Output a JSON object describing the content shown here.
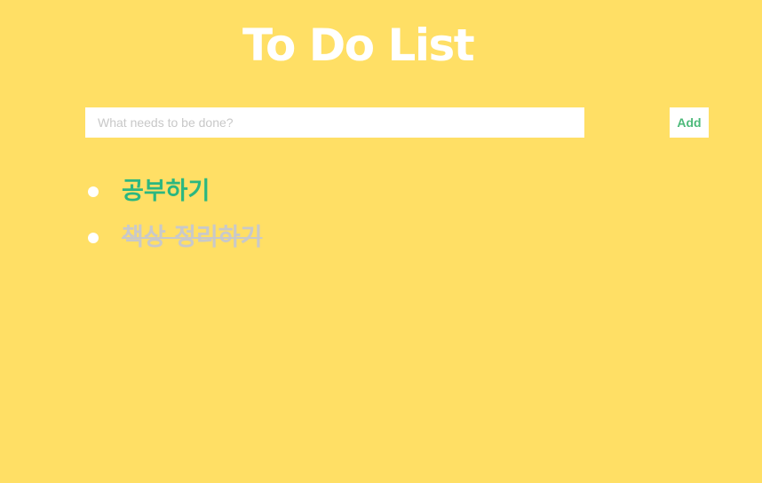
{
  "app": {
    "title": "To Do List"
  },
  "form": {
    "placeholder": "What needs to be done?",
    "value": "",
    "add_label": "Add"
  },
  "todos": [
    {
      "text": "공부하기",
      "status": "active"
    },
    {
      "text": "책상 정리하기",
      "status": "done"
    }
  ],
  "colors": {
    "background": "#FFDF65",
    "title": "#FFFFFF",
    "active_text": "#2BB780",
    "done_text": "#C9C9C9",
    "add_button_text": "#4CB97A"
  }
}
